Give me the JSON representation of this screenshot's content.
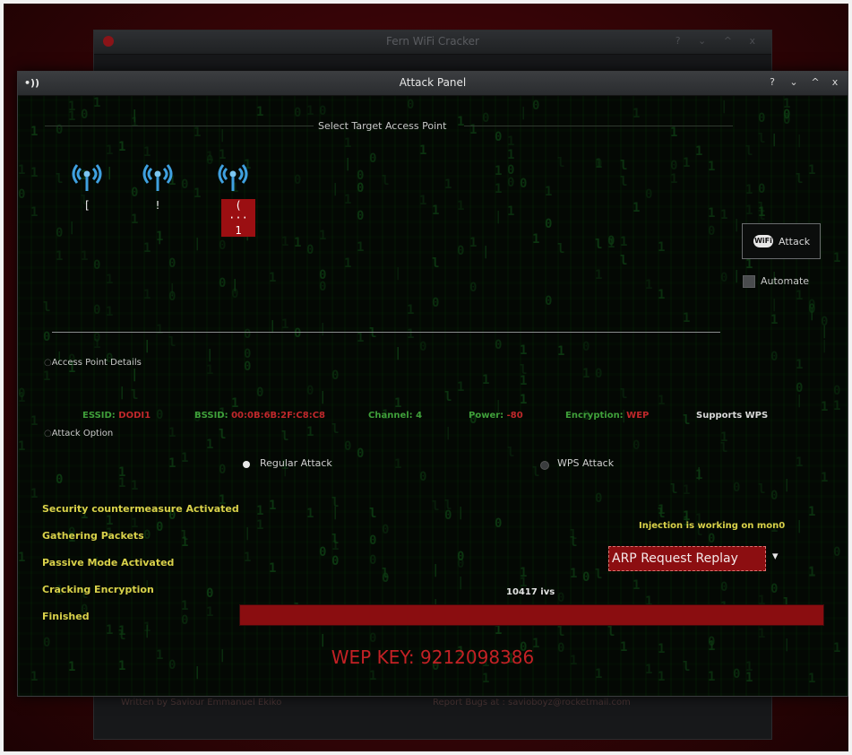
{
  "background_window": {
    "title": "Fern WiFi Cracker",
    "footer_left": "Written by Saviour Emmanuel Ekiko",
    "footer_right": "Report Bugs at : savioboyz@rocketmail.com"
  },
  "dialog": {
    "title": "Attack Panel",
    "app_icon": "wifi-icon",
    "buttons": [
      "?",
      "⌄",
      "^",
      "x"
    ]
  },
  "select_target": {
    "label": "Select Target Access Point"
  },
  "access_points": [
    {
      "name": "["
    },
    {
      "name": "!"
    },
    {
      "name": "( ··· 1",
      "selected": true
    }
  ],
  "attack_button": {
    "logo": "WiFi",
    "label": "Attack"
  },
  "automate": {
    "label": "Automate",
    "checked": false
  },
  "details": {
    "heading": "Access Point Details",
    "essid_key": "ESSID:",
    "essid_val": "DODI1",
    "bssid_key": "BSSID:",
    "bssid_val": "00:0B:6B:2F:C8:C8",
    "channel_key": "Channel:",
    "channel_val": "4",
    "power_key": "Power:",
    "power_val": "-80",
    "encryption_key": "Encryption:",
    "encryption_val": "WEP",
    "wps_note": "Supports WPS"
  },
  "attack_option": {
    "heading": "Attack Option",
    "regular_label": "Regular Attack",
    "wps_label": "WPS  Attack",
    "selected": "regular"
  },
  "status_list": [
    "Security countermeasure Activated",
    "Gathering Packets",
    "Passive Mode Activated",
    "Cracking Encryption",
    "Finished"
  ],
  "injection_status": "Injection is working on mon0",
  "attack_mode": {
    "selected": "ARP Request Replay"
  },
  "ivs_label": "10417 ivs",
  "progress_fraction": 1.0,
  "wep_key": "WEP KEY: 9212098386",
  "colors": {
    "accent_red": "#8c0e11",
    "status_yellow": "#d9d14a",
    "key_green": "#3fa03a",
    "value_red": "#c0282b"
  }
}
